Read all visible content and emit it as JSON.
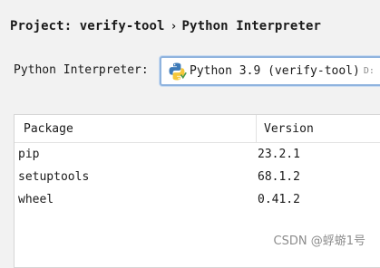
{
  "header": {
    "project_label": "Project: verify-tool",
    "separator": "›",
    "page_title": "Python Interpreter"
  },
  "interpreter": {
    "label": "Python Interpreter:",
    "icon": "python-icon",
    "selected_name": "Python 3.9 (verify-tool)",
    "selected_path": "D:"
  },
  "packages": {
    "columns": [
      "Package",
      "Version"
    ],
    "rows": [
      {
        "package": "pip",
        "version": "23.2.1"
      },
      {
        "package": "setuptools",
        "version": "68.1.2"
      },
      {
        "package": "wheel",
        "version": "0.41.2"
      }
    ]
  },
  "watermark": "CSDN @蜉蝣1号",
  "colors": {
    "select_border": "#8fb3de",
    "python_blue": "#3d7ab8",
    "python_yellow": "#f5c73a"
  }
}
